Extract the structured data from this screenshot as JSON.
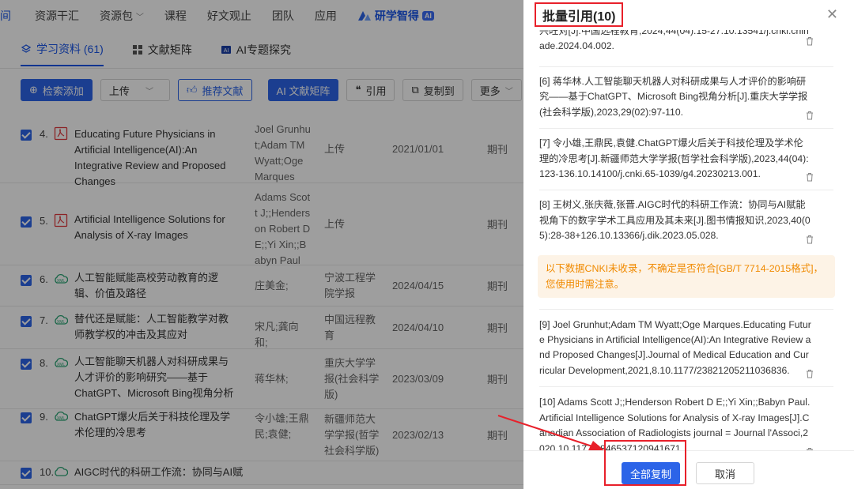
{
  "topnav": {
    "items": [
      "间",
      "资源干汇",
      "资源包",
      "课程",
      "好文观止",
      "团队",
      "应用"
    ],
    "ai_brand": "研学智得",
    "ai_badge": "AI"
  },
  "tabs": [
    {
      "label": "学习资料 (61)",
      "icon": "stack-icon"
    },
    {
      "label": "文献矩阵",
      "icon": "grid-icon"
    },
    {
      "label": "AI专题探究",
      "icon": "ai-icon"
    }
  ],
  "toolbar": {
    "search_add": "检索添加",
    "upload": "上传",
    "recommend": "推荐文献",
    "ai_matrix": "AI 文献矩阵",
    "cite": "引用",
    "copy_to": "复制到",
    "more": "更多"
  },
  "rows": [
    {
      "idx": "4.",
      "type": "pdf",
      "title": "Educating Future Physicians in Artificial Intelligence(AI):An Integrative Review and Proposed Changes",
      "authors": "Joel Grunhut;Adam TM Wyatt;Oge Marques",
      "source": "上传",
      "date": "2021/01/01",
      "kind": "期刊"
    },
    {
      "idx": "5.",
      "type": "pdf",
      "title": "Artificial Intelligence Solutions for Analysis of X-ray Images",
      "authors": "Adams Scott J;;Henderson Robert D E;;Yi Xin;;Babyn Paul",
      "source": "上传",
      "date": "",
      "kind": "期刊"
    },
    {
      "idx": "6.",
      "type": "xml",
      "title": "人工智能赋能高校劳动教育的逻辑、价值及路径",
      "authors": "庄美金;",
      "source": "宁波工程学院学报",
      "date": "2024/04/15",
      "kind": "期刊"
    },
    {
      "idx": "7.",
      "type": "xml",
      "title": "替代还是赋能：人工智能教学对教师教学权的冲击及其应对",
      "authors": "宋凡;龚向和;",
      "source": "中国远程教育",
      "date": "2024/04/10",
      "kind": "期刊"
    },
    {
      "idx": "8.",
      "type": "xml",
      "title": "人工智能聊天机器人对科研成果与人才评价的影响研究——基于ChatGPT、Microsoft Bing视角分析",
      "authors": "蒋华林;",
      "source": "重庆大学学报(社会科学版)",
      "date": "2023/03/09",
      "kind": "期刊"
    },
    {
      "idx": "9.",
      "type": "xml",
      "title": "ChatGPT爆火后关于科技伦理及学术伦理的冷思考",
      "authors": "令小雄;王鼎民;袁健;",
      "source": "新疆师范大学学报(哲学社会科学版)",
      "date": "2023/02/13",
      "kind": "期刊"
    },
    {
      "idx": "10.",
      "type": "xml",
      "title": "AIGC时代的科研工作流：协同与AI赋",
      "authors": "",
      "source": "",
      "date": "",
      "kind": ""
    }
  ],
  "drawer": {
    "title": "批量引用(10)",
    "citations_top": [
      "兴旺对[J].中国远程教育,2024,44(04):15-27.10.13541/j.cnki.chinade.2024.04.002.",
      "[6] 蒋华林.人工智能聊天机器人对科研成果与人才评价的影响研究——基于ChatGPT、Microsoft Bing视角分析[J].重庆大学学报(社会科学版),2023,29(02):97-110.",
      "[7] 令小雄,王鼎民,袁健.ChatGPT爆火后关于科技伦理及学术伦理的冷思考[J].新疆师范大学学报(哲学社会科学版),2023,44(04):123-136.10.14100/j.cnki.65-1039/g4.20230213.001.",
      "[8] 王树义,张庆薇,张晋.AIGC时代的科研工作流：协同与AI赋能视角下的数字学术工具应用及其未来[J].图书情报知识,2023,40(05):28-38+126.10.13366/j.dik.2023.05.028."
    ],
    "warning": "以下数据CNKI未收录，不确定是否符合[GB/T 7714-2015格式]，您使用时需注意。",
    "citations_bottom": [
      "[9] Joel Grunhut;Adam TM Wyatt;Oge Marques.Educating Future Physicians in Artificial Intelligence(AI):An Integrative Review and Proposed Changes[J].Journal of Medical Education and Curricular Development,2021,8.10.1177/23821205211036836.",
      "[10] Adams Scott J;;Henderson Robert D E;;Yi Xin;;Babyn Paul.Artificial Intelligence Solutions for Analysis of X-ray Images[J].Canadian Association of Radiologists journal = Journal l'Associ,2020.10.1177/0846537120941671."
    ],
    "copy_all": "全部复制",
    "cancel": "取消"
  },
  "colors": {
    "primary": "#2c64e8",
    "highlight_box": "#e8202a",
    "warning_text": "#f08a00",
    "warning_bg": "#fdf3e6"
  }
}
